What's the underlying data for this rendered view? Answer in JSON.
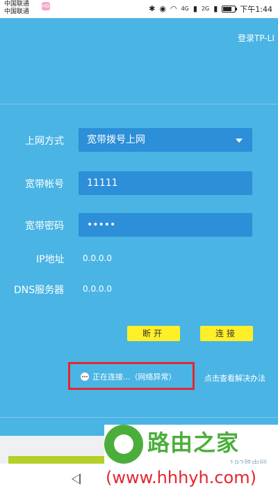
{
  "status_bar": {
    "carrier_1": "中国联通",
    "carrier_2": "中国联通",
    "carrier_badge": "HD",
    "signal_1": "4G",
    "signal_2": "2G",
    "time": "下午1:44",
    "battery_level": 0.75
  },
  "header": {
    "login_text": "登录TP-LI"
  },
  "form": {
    "mode_label": "上网方式",
    "mode_value": "宽带拨号上网",
    "account_label": "宽带帐号",
    "account_value": "11111",
    "password_label": "宽带密码",
    "password_value": "•••••",
    "ip_label": "IP地址",
    "ip_value": "0.0.0.0",
    "dns_label": "DNS服务器",
    "dns_value": "0.0.0.0"
  },
  "buttons": {
    "disconnect": "断开",
    "connect": "连接"
  },
  "status": {
    "connecting_text": "正在连接...（网络异常）",
    "help_link": "点击查看解决办法"
  },
  "watermark": {
    "title": "路由之家",
    "site_192": "192路由网",
    "url": "(www.hhhyh.com)"
  },
  "colors": {
    "main_blue": "#4ab4e4",
    "field_blue": "#2c8fd8",
    "button_yellow": "#ffef28",
    "highlight_red": "#e4262e",
    "watermark_green": "#4cae3a"
  }
}
